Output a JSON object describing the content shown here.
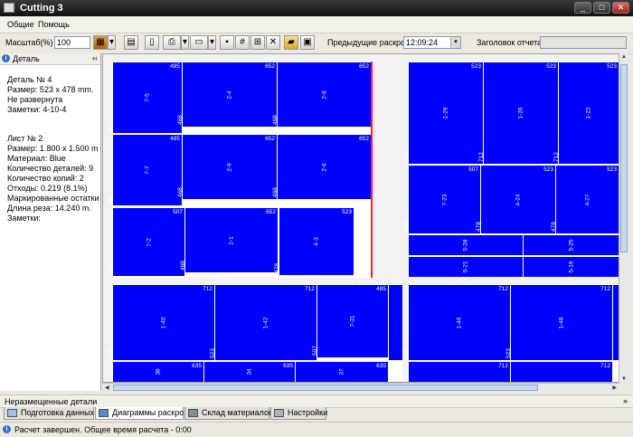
{
  "window": {
    "title": "Cutting 3"
  },
  "menu": [
    "Общие",
    "Помощь"
  ],
  "toolbar": {
    "scale_label": "Масштаб(%)",
    "scale_value": "100",
    "prev_layouts_label": "Предыдущие раскрои",
    "prev_layouts_value": "12:09:24",
    "report_title_label": "Заголовок отчета",
    "report_title_value": ""
  },
  "left_panel": {
    "title": "Деталь",
    "collapse": "‹‹",
    "detail_lines": [
      "Деталь № 4",
      "Размер: 523 x 478 mm.",
      "Не развернута",
      "Заметки: 4-10-4"
    ],
    "sheet_lines": [
      "Лист № 2",
      "Размер: 1.800 x 1.500 m",
      "Материал: Blue",
      "Количество деталей: 9",
      "Количество копий: 2",
      "Отходы: 0.219 (8.1%)",
      "Маркированные остатки",
      "Длина реза: 14.240 m.",
      "Заметки:"
    ]
  },
  "pieces": {
    "s1": [
      {
        "w": "485",
        "h": "507",
        "c": "7-5"
      },
      {
        "w": "652",
        "h": "468",
        "c": "2-4"
      },
      {
        "w": "652",
        "h": "468",
        "c": "2-8"
      },
      {
        "w": "485",
        "h": "507",
        "c": "7-7"
      },
      {
        "w": "652",
        "h": "468",
        "c": "2-9"
      },
      {
        "w": "652",
        "h": "468",
        "c": "2-6"
      },
      {
        "w": "507",
        "h": "485",
        "c": "7-2"
      },
      {
        "w": "652",
        "h": "468",
        "c": "2-1"
      },
      {
        "w": "523",
        "h": "478",
        "c": "4-3"
      }
    ],
    "s2": [
      {
        "w": "523",
        "h": "712",
        "c": "1-29"
      },
      {
        "w": "523",
        "h": "712",
        "c": "1-26"
      },
      {
        "w": "523",
        "h": "712",
        "c": "1-22"
      },
      {
        "w": "507",
        "h": "485",
        "c": "7-23"
      },
      {
        "w": "523",
        "h": "478",
        "c": "4-24"
      },
      {
        "w": "523",
        "h": "478",
        "c": "4-27"
      },
      {
        "w": "",
        "h": "",
        "c": "5-28"
      },
      {
        "w": "",
        "h": "",
        "c": "5-25"
      },
      {
        "w": "",
        "h": "",
        "c": "5-21"
      },
      {
        "w": "",
        "h": "",
        "c": "5-19"
      }
    ],
    "s3": [
      {
        "w": "712",
        "h": "523",
        "c": "1-40"
      },
      {
        "w": "712",
        "h": "523",
        "c": "1-42"
      },
      {
        "w": "485",
        "h": "507",
        "c": "7-31"
      },
      {
        "w": "635",
        "h": "",
        "c": "38"
      },
      {
        "w": "635",
        "h": "",
        "c": "34"
      },
      {
        "w": "635",
        "h": "",
        "c": "37"
      }
    ],
    "s4": [
      {
        "w": "712",
        "h": "523",
        "c": "1-46"
      },
      {
        "w": "712",
        "h": "523",
        "c": "1-48"
      },
      {
        "w": "712",
        "h": "",
        "c": ""
      },
      {
        "w": "712",
        "h": "",
        "c": ""
      }
    ]
  },
  "bottom_bar": {
    "label": "Неразмещенные детали",
    "expand": "»"
  },
  "tabs": [
    {
      "label": "Подготовка данных"
    },
    {
      "label": "Диаграммы раскроя"
    },
    {
      "label": "Склад материалов"
    },
    {
      "label": "Настройки"
    }
  ],
  "status": {
    "text": "Расчет завершен. Общее время расчета - 0:00"
  }
}
